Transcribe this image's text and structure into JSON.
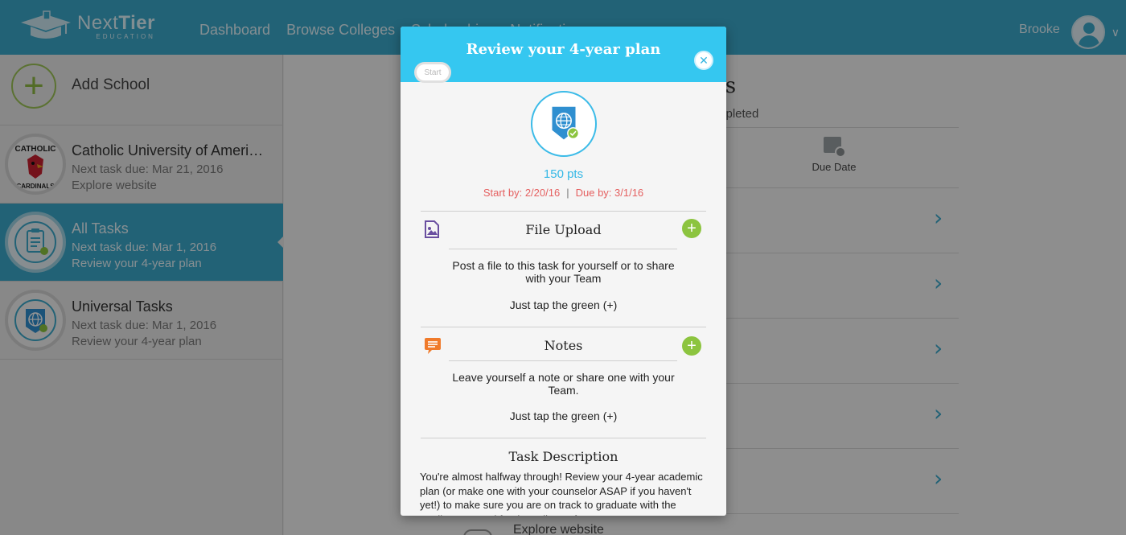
{
  "header": {
    "logo": {
      "name_part1": "Next",
      "name_part2": "Tier",
      "sub": "EDUCATION"
    },
    "nav": [
      "Dashboard",
      "Browse Colleges",
      "Scholarships",
      "Notifications"
    ],
    "user": {
      "name": "Brooke"
    }
  },
  "sidebar": {
    "add_school_label": "Add School",
    "items": [
      {
        "title": "Catholic University of Ameri…",
        "sub1": "Next task due: Mar 21, 2016",
        "sub2": "Explore website",
        "badge_top": "CATHOLIC",
        "badge_bottom": "CARDINALS"
      },
      {
        "title": "All Tasks",
        "sub1": "Next task due: Mar 1, 2016",
        "sub2": "Review your 4-year plan"
      },
      {
        "title": "Universal Tasks",
        "sub1": "Next task due: Mar 1, 2016",
        "sub2": "Review your 4-year plan"
      }
    ]
  },
  "main": {
    "title_fragment": "ks",
    "completed_fragment": "mpleted",
    "due_date_label": "Due Date",
    "explore_row_label": "Explore website"
  },
  "modal": {
    "title": "Review your 4-year plan",
    "start_label": "Start",
    "points": "150 pts",
    "start_by": "Start by: 2/20/16",
    "separator": "|",
    "due_by": "Due by: 3/1/16",
    "file_upload": {
      "title": "File Upload",
      "text": "Post a file to this task for yourself or to share with your Team",
      "tap": "Just tap the green (+)"
    },
    "notes": {
      "title": "Notes",
      "text": "Leave yourself a note or share one with your Team.",
      "tap": "Just tap the green (+)"
    },
    "description": {
      "title": "Task Description",
      "text": "You're almost halfway through! Review your 4-year academic plan (or make one with your counselor ASAP if you haven't yet!) to make sure you are on track to graduate with the credits you need for the college of"
    }
  },
  "colors": {
    "brand_blue": "#3ba9cc",
    "modal_header": "#35c7f0",
    "accent_green": "#8cc43f",
    "date_red": "#e56161",
    "upload_icon": "#6a4fa0",
    "notes_icon": "#f07a2a"
  },
  "icons": [
    "graduation-cap-logo",
    "plus-icon",
    "clipboard-icon",
    "globe-shield-icon",
    "calendar-check-icon",
    "chevron-right-icon",
    "close-icon",
    "image-file-icon",
    "speech-bubble-icon"
  ]
}
